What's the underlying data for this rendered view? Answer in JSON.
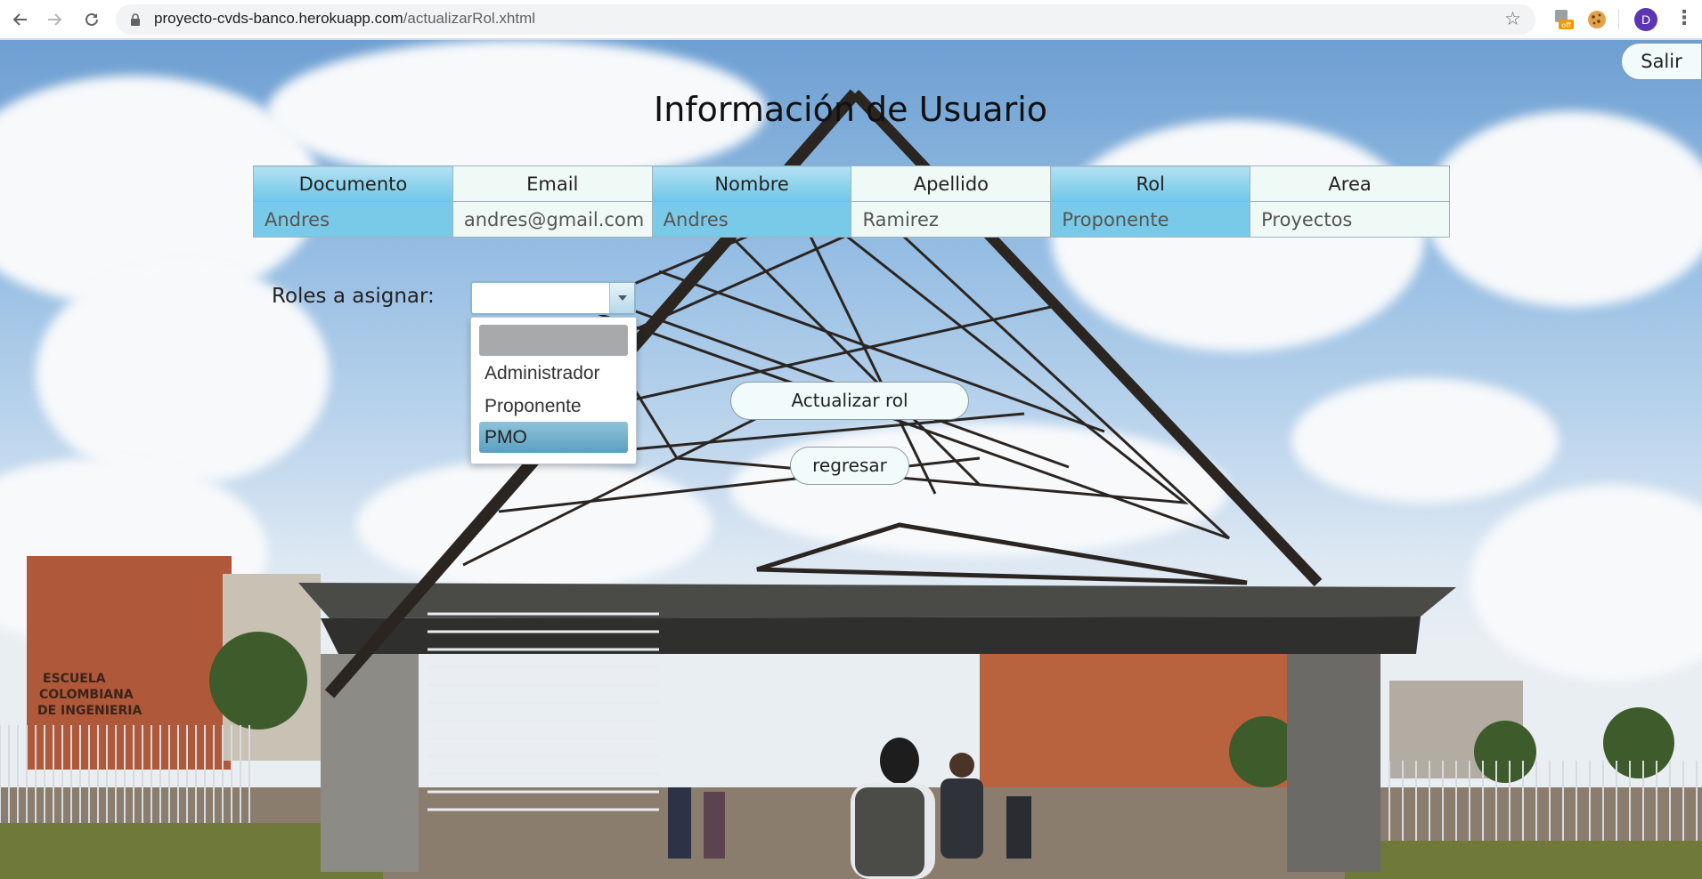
{
  "browser": {
    "url_host": "proyecto-cvds-banco.herokuapp.com",
    "url_path": "/actualizarRol.xhtml",
    "extension_badge": "off",
    "profile_initial": "D"
  },
  "header": {
    "logout_label": "Salir",
    "title": "Información de Usuario"
  },
  "user_table": {
    "headers": [
      "Documento",
      "Email",
      "Nombre",
      "Apellido",
      "Rol",
      "Area"
    ],
    "row": [
      "Andres",
      "andres@gmail.com",
      "Andres",
      "Ramirez",
      "Proponente",
      "Proyectos"
    ]
  },
  "roles": {
    "label": "Roles a asignar:",
    "selected": "",
    "options": [
      "",
      "Administrador",
      "Proponente",
      "PMO"
    ],
    "highlighted": "PMO"
  },
  "actions": {
    "update_label": "Actualizar rol",
    "back_label": "regresar"
  },
  "background": {
    "sign_lines": [
      "ESCUELA",
      "COLOMBIANA",
      "DE INGENIERIA"
    ]
  }
}
